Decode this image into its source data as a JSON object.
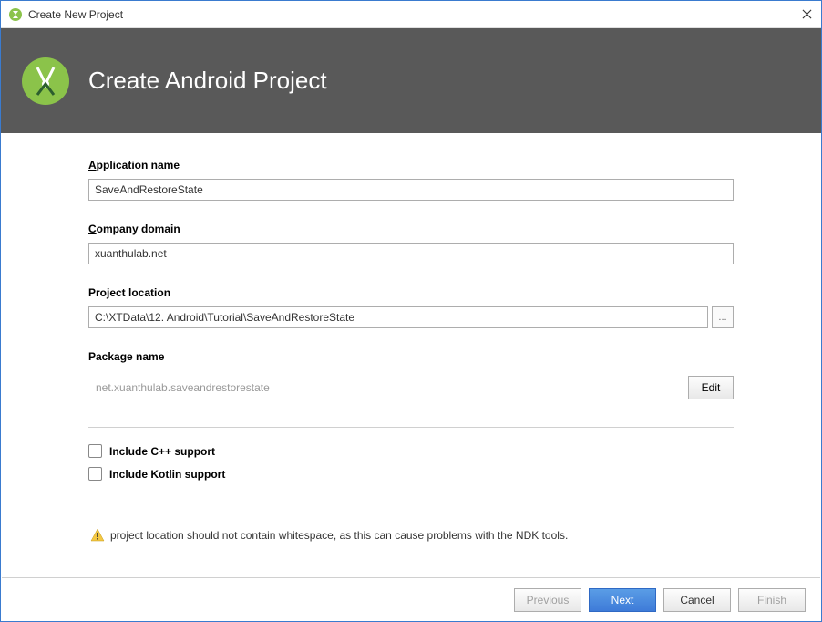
{
  "window": {
    "title": "Create New Project"
  },
  "header": {
    "title": "Create Android Project"
  },
  "fields": {
    "app_name": {
      "label_pre": "A",
      "label_rest": "pplication name",
      "value": "SaveAndRestoreState"
    },
    "company": {
      "label_pre": "C",
      "label_rest": "ompany domain",
      "value": "xuanthulab.net"
    },
    "location": {
      "label": "Project location",
      "value": "C:\\XTData\\12. Android\\Tutorial\\SaveAndRestoreState",
      "browse": "..."
    },
    "package": {
      "label": "Package name",
      "value": "net.xuanthulab.saveandrestorestate",
      "edit": "Edit"
    }
  },
  "checks": {
    "cpp": "Include C++ support",
    "kotlin": "Include Kotlin support"
  },
  "warning": {
    "text": "project location should not contain whitespace, as this can cause problems with the NDK tools."
  },
  "footer": {
    "previous": "Previous",
    "next": "Next",
    "cancel": "Cancel",
    "finish": "Finish"
  }
}
